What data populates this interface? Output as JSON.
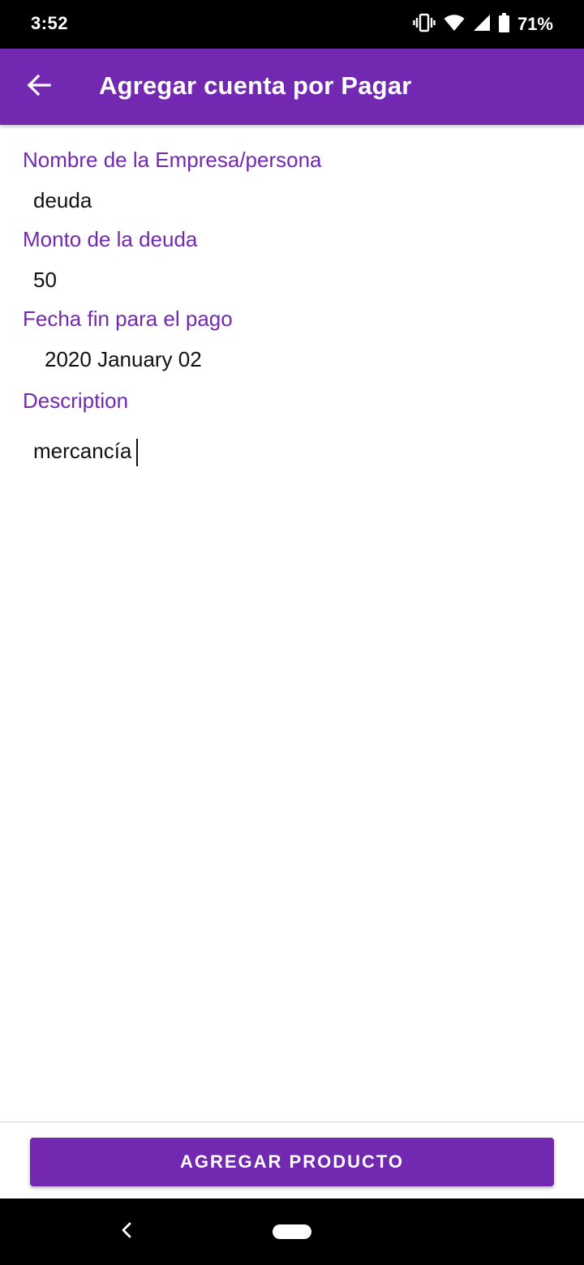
{
  "status_bar": {
    "time": "3:52",
    "battery_percent": "71%",
    "icons": [
      "vibrate-icon",
      "wifi-icon",
      "cell-signal-icon",
      "battery-icon"
    ]
  },
  "app_bar": {
    "title": "Agregar cuenta por Pagar",
    "back_icon": "arrow-back-icon",
    "color": "#7228b0"
  },
  "form": {
    "name": {
      "label": "Nombre de la Empresa/persona",
      "value": "deuda"
    },
    "amount": {
      "label": "Monto de la deuda",
      "value": "50"
    },
    "due_date": {
      "label": "Fecha fin para el pago",
      "value": "2020 January 02"
    },
    "description": {
      "label": "Description",
      "value": "mercancía"
    }
  },
  "actions": {
    "submit_label": "AGREGAR PRODUCTO"
  },
  "nav_bar": {
    "back_icon": "nav-back-icon",
    "home_icon": "nav-home-pill-icon"
  },
  "colors": {
    "accent": "#7228b0",
    "text": "#111111",
    "background": "#ffffff"
  }
}
